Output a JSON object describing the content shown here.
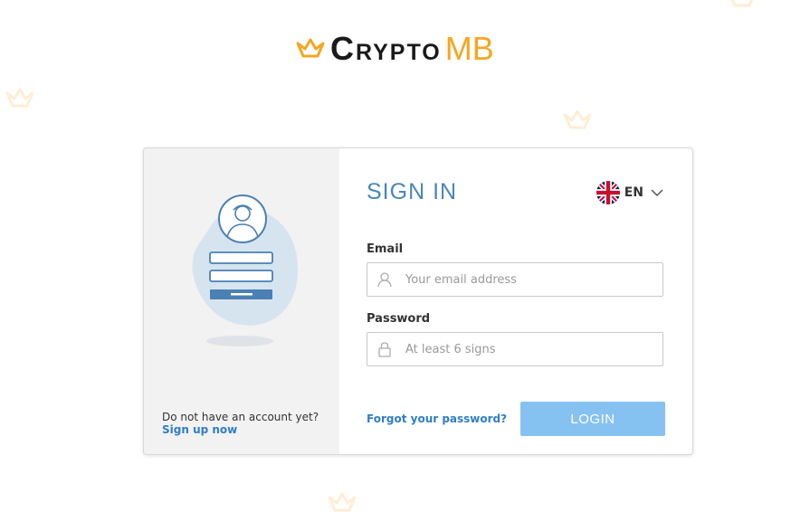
{
  "brand": {
    "name_part1": "Crypto",
    "name_part2": "MB",
    "accent_color": "#f5a623"
  },
  "signin": {
    "title": "SIGN IN",
    "language": {
      "code": "EN",
      "flag": "uk-flag-icon"
    },
    "email": {
      "label": "Email",
      "placeholder": "Your email address",
      "value": ""
    },
    "password": {
      "label": "Password",
      "placeholder": "At least 6 signs",
      "value": ""
    },
    "forgot_label": "Forgot your password?",
    "login_label": "LOGIN"
  },
  "signup": {
    "prompt": "Do not have an account yet?",
    "link_label": "Sign up now"
  },
  "colors": {
    "primary_blue": "#4a86b8",
    "link_blue": "#2f7ec7",
    "login_button": "#86c2f1"
  }
}
